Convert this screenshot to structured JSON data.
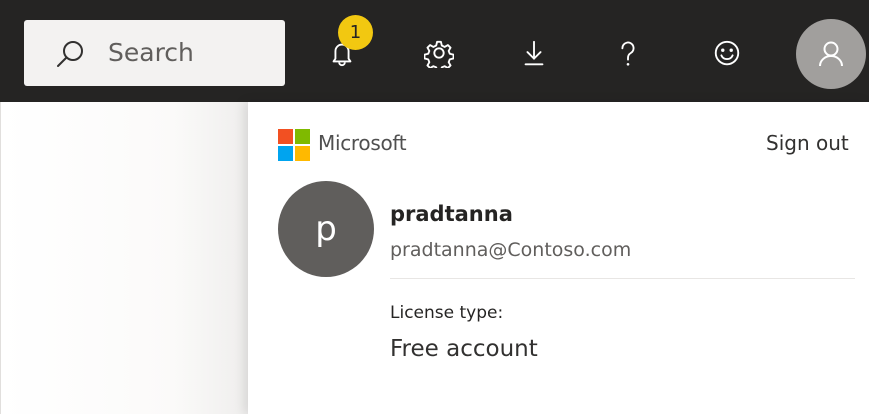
{
  "topbar": {
    "search_placeholder": "Search",
    "notifications": {
      "icon": "bell-icon",
      "badge_count": "1"
    },
    "settings_icon": "gear-icon",
    "download_icon": "download-arrow-icon",
    "help_icon": "question-mark-icon",
    "feedback_icon": "smiley-icon",
    "account_icon": "person-icon"
  },
  "account_panel": {
    "brand": "Microsoft",
    "sign_out_label": "Sign out",
    "avatar_initial": "p",
    "user_name": "pradtanna",
    "user_email": "pradtanna@Contoso.com",
    "license_label": "License type:",
    "license_value": "Free account"
  },
  "colors": {
    "topbar_bg": "#252423",
    "search_bg": "#f3f2f1",
    "badge": "#f2c811",
    "avatar_button": "#a19f9d",
    "user_avatar": "#605e5c",
    "ms_red": "#f25022",
    "ms_green": "#7fba00",
    "ms_blue": "#00a4ef",
    "ms_yellow": "#ffb900"
  }
}
